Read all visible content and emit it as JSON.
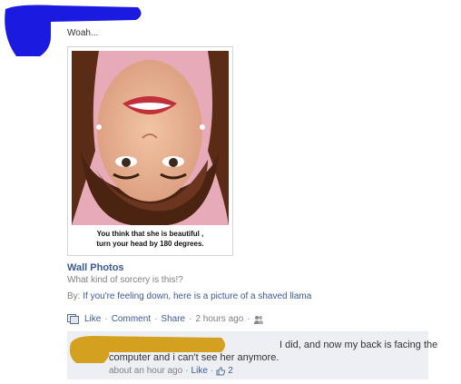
{
  "post": {
    "status_text": "Woah...",
    "photo_caption_line1": "You think that she is beautiful ,",
    "photo_caption_line2": "turn your head by 180 degrees.",
    "album_link": "Wall Photos",
    "album_description": "What kind of sorcery is this!?",
    "by_prefix": "By:",
    "by_link": "If you're feeling down, here is a picture of a shaved llama",
    "actions": {
      "like": "Like",
      "comment": "Comment",
      "share": "Share",
      "separator": "·",
      "time": "2 hours ago"
    }
  },
  "comment": {
    "line1": "I did, and now my back is facing the",
    "line2": "computer and i can't see her anymore.",
    "time": "about an hour ago",
    "like": "Like",
    "separator": "·",
    "like_count": "2"
  },
  "colors": {
    "link": "#3b5998",
    "redact_blue": "#1a1ae0",
    "redact_gold": "#d4a020",
    "comment_bg": "#edeff4"
  }
}
